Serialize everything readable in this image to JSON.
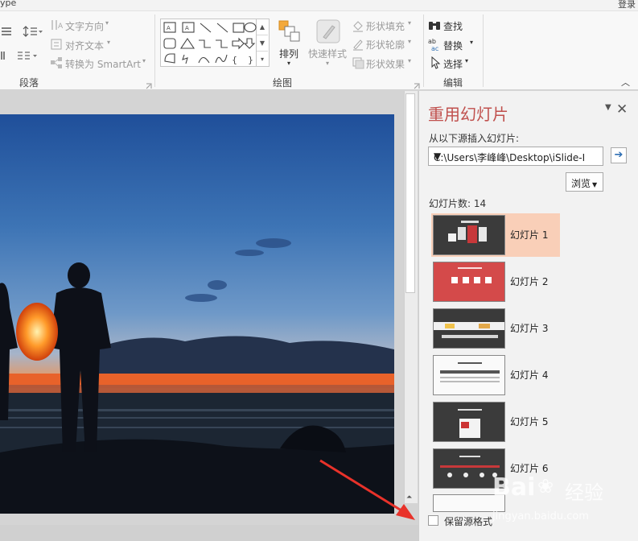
{
  "title_fragment": "ype",
  "login": "登录",
  "ribbon": {
    "text_direction": "文字方向",
    "align_text": "对齐文本",
    "convert_smartart": "转换为 SmartArt",
    "group_paragraph": "段落",
    "group_drawing": "绘图",
    "group_editing": "编辑",
    "arrange": "排列",
    "quick_styles": "快速样式",
    "shape_fill": "形状填充",
    "shape_outline": "形状轮廓",
    "shape_effects": "形状效果",
    "find": "查找",
    "replace": "替换",
    "select": "选择"
  },
  "pane": {
    "title": "重用幻灯片",
    "source_label": "从以下源插入幻灯片:",
    "path_value": "C:\\Users\\李峰峰\\Desktop\\iSlide-I",
    "browse": "浏览",
    "count_label": "幻灯片数: 14",
    "keep_format": "保留源格式",
    "slides": [
      {
        "label": "幻灯片 1",
        "selected": true
      },
      {
        "label": "幻灯片 2",
        "selected": false
      },
      {
        "label": "幻灯片 3",
        "selected": false
      },
      {
        "label": "幻灯片 4",
        "selected": false
      },
      {
        "label": "幻灯片 5",
        "selected": false
      },
      {
        "label": "幻灯片 6",
        "selected": false
      }
    ]
  },
  "watermark": {
    "brand": "Bai",
    "brand2": "经验",
    "url": "jingyan.baidu.com"
  },
  "colors": {
    "accent": "#c0504d",
    "selected": "#f9cfb8",
    "annotation": "#e8322a"
  }
}
